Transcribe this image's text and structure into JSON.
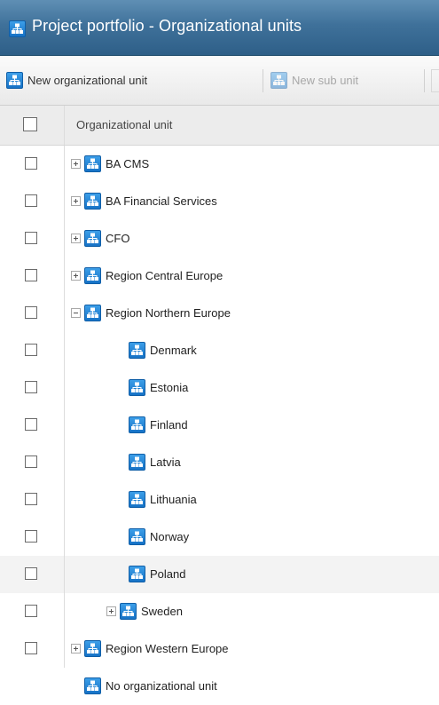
{
  "window": {
    "title": "Project portfolio - Organizational units"
  },
  "toolbar": {
    "new_unit_label": "New organizational unit",
    "new_sub_unit_label": "New sub unit"
  },
  "grid": {
    "header": {
      "column_label": "Organizational unit"
    },
    "rows": [
      {
        "label": "BA CMS",
        "level": 0,
        "expander": "plus",
        "checkbox": true
      },
      {
        "label": "BA Financial Services",
        "level": 0,
        "expander": "plus",
        "checkbox": true
      },
      {
        "label": "CFO",
        "level": 0,
        "expander": "plus",
        "checkbox": true
      },
      {
        "label": "Region Central Europe",
        "level": 0,
        "expander": "plus",
        "checkbox": true
      },
      {
        "label": "Region Northern Europe",
        "level": 0,
        "expander": "minus",
        "checkbox": true
      },
      {
        "label": "Denmark",
        "level": 1,
        "expander": "none",
        "checkbox": true
      },
      {
        "label": "Estonia",
        "level": 1,
        "expander": "none",
        "checkbox": true
      },
      {
        "label": "Finland",
        "level": 1,
        "expander": "none",
        "checkbox": true
      },
      {
        "label": "Latvia",
        "level": 1,
        "expander": "none",
        "checkbox": true
      },
      {
        "label": "Lithuania",
        "level": 1,
        "expander": "none",
        "checkbox": true
      },
      {
        "label": "Norway",
        "level": 1,
        "expander": "none",
        "checkbox": true
      },
      {
        "label": "Poland",
        "level": 1,
        "expander": "none",
        "checkbox": true
      },
      {
        "label": "Sweden",
        "level": 1,
        "expander": "plus",
        "checkbox": true
      },
      {
        "label": "Region Western Europe",
        "level": 0,
        "expander": "plus",
        "checkbox": true
      },
      {
        "label": "No organizational unit",
        "level": 0,
        "expander": "none",
        "checkbox": false
      }
    ]
  },
  "icons": {
    "org_unit": "org-chart-icon",
    "expand": "expand-icon",
    "collapse": "collapse-icon"
  },
  "colors": {
    "titlebar": "#3f719a",
    "icon_blue": "#1672c6",
    "alt_row": "#f3f3f3"
  }
}
